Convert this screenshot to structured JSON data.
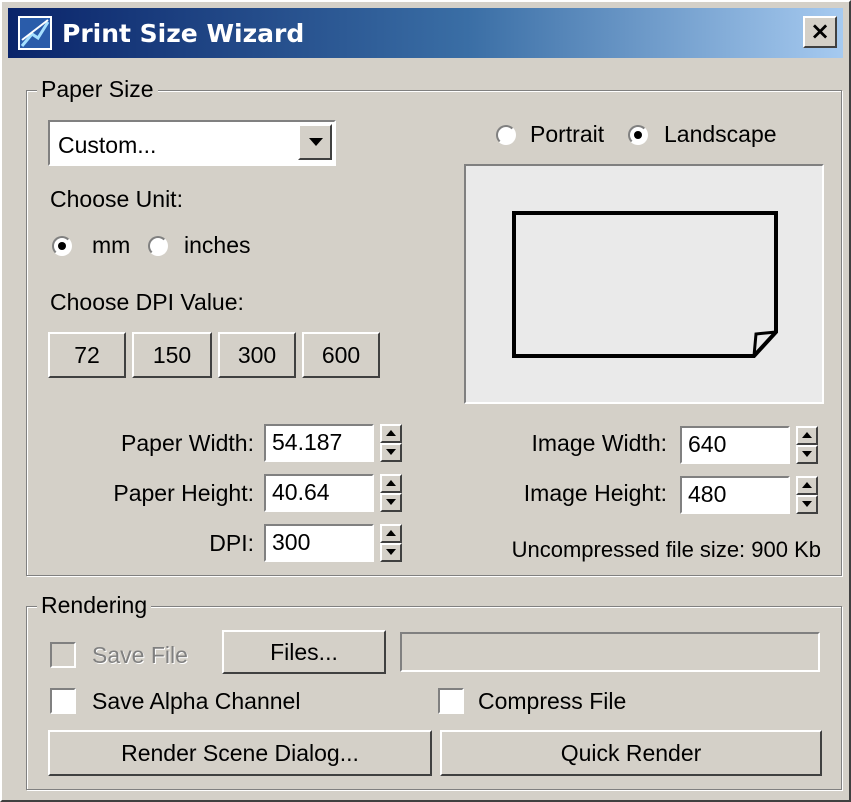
{
  "window": {
    "title": "Print Size Wizard",
    "close_label": "×"
  },
  "paper_size": {
    "legend": "Paper Size",
    "preset_value": "Custom...",
    "choose_unit_label": "Choose Unit:",
    "unit_options": [
      {
        "label": "mm",
        "checked": true
      },
      {
        "label": "inches",
        "checked": false
      }
    ],
    "choose_dpi_label": "Choose DPI Value:",
    "dpi_buttons": [
      "72",
      "150",
      "300",
      "600"
    ],
    "orientation": [
      {
        "label": "Portrait",
        "checked": false
      },
      {
        "label": "Landscape",
        "checked": true
      }
    ],
    "paper_width_label": "Paper Width:",
    "paper_width_value": "54.187",
    "paper_height_label": "Paper Height:",
    "paper_height_value": "40.64",
    "dpi_label": "DPI:",
    "dpi_value": "300",
    "image_width_label": "Image Width:",
    "image_width_value": "640",
    "image_height_label": "Image Height:",
    "image_height_value": "480",
    "file_size_text": "Uncompressed file size: 900 Kb"
  },
  "rendering": {
    "legend": "Rendering",
    "save_file_label": "Save File",
    "files_button_label": "Files...",
    "file_path_value": "",
    "save_alpha_label": "Save Alpha Channel",
    "compress_file_label": "Compress File",
    "render_scene_button_label": "Render Scene Dialog...",
    "quick_render_button_label": "Quick Render"
  },
  "colors": {
    "titlebar_start": "#0a246a",
    "titlebar_end": "#a6caf0",
    "face": "#d4d0c8"
  },
  "icons": [
    "app-icon",
    "close-icon",
    "dropdown-arrow-icon",
    "spinner-icon",
    "page-landscape-icon"
  ]
}
